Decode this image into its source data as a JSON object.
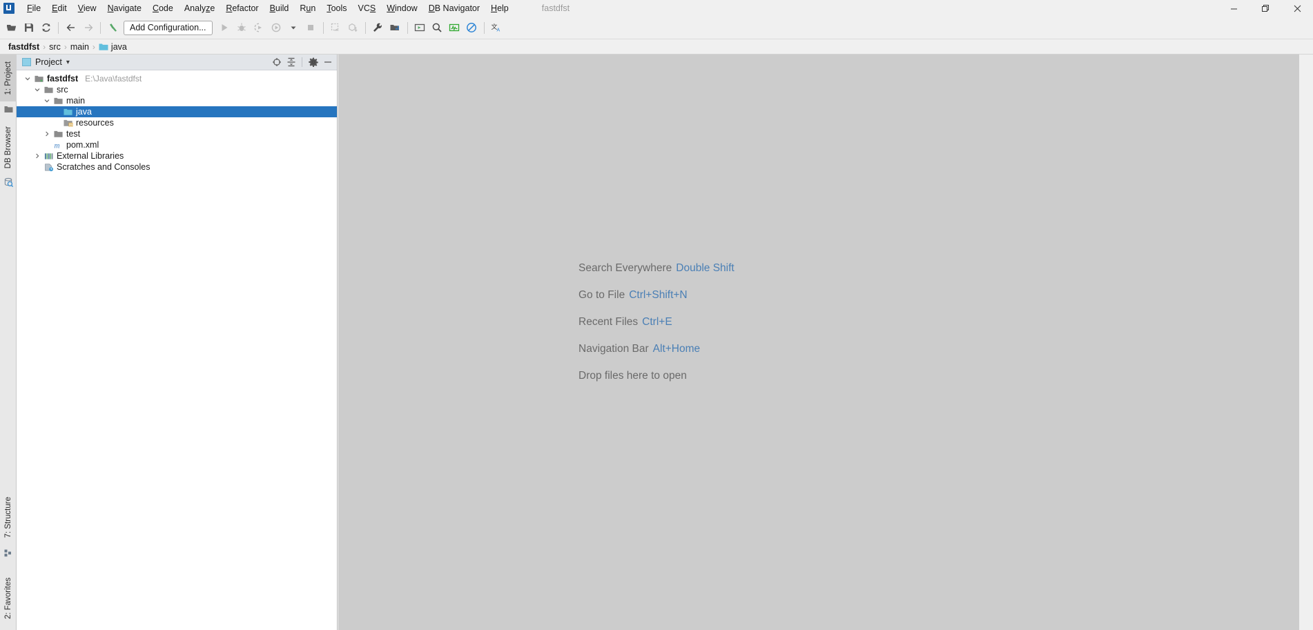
{
  "window": {
    "title": "fastdfst",
    "logo_name": "intellij-idea-logo",
    "controls": [
      {
        "name": "minimize-button",
        "glyph": "minimize"
      },
      {
        "name": "maximize-button",
        "glyph": "restore"
      },
      {
        "name": "close-button",
        "glyph": "close"
      }
    ]
  },
  "menubar": {
    "items": [
      {
        "label": "File",
        "mnemonic": "F"
      },
      {
        "label": "Edit",
        "mnemonic": "E"
      },
      {
        "label": "View",
        "mnemonic": "V"
      },
      {
        "label": "Navigate",
        "mnemonic": "N"
      },
      {
        "label": "Code",
        "mnemonic": "C"
      },
      {
        "label": "Analyze",
        "mnemonic": "z"
      },
      {
        "label": "Refactor",
        "mnemonic": "R"
      },
      {
        "label": "Build",
        "mnemonic": "B"
      },
      {
        "label": "Run",
        "mnemonic": "u"
      },
      {
        "label": "Tools",
        "mnemonic": "T"
      },
      {
        "label": "VCS",
        "mnemonic": "S"
      },
      {
        "label": "Window",
        "mnemonic": "W"
      },
      {
        "label": "DB Navigator",
        "mnemonic": "D"
      },
      {
        "label": "Help",
        "mnemonic": "H"
      }
    ]
  },
  "toolbar": {
    "add_configuration_label": "Add Configuration...",
    "icons": [
      {
        "name": "open-project-icon",
        "title": "Open"
      },
      {
        "name": "save-all-icon",
        "title": "Save All"
      },
      {
        "name": "sync-refresh-icon",
        "title": "Synchronize"
      },
      {
        "name": "navigate-back-icon",
        "title": "Back"
      },
      {
        "name": "navigate-forward-icon",
        "title": "Forward"
      },
      {
        "name": "build-hammer-icon",
        "title": "Build Project"
      },
      {
        "name": "run-icon",
        "title": "Run"
      },
      {
        "name": "debug-icon",
        "title": "Debug"
      },
      {
        "name": "run-with-coverage-icon",
        "title": "Run with Coverage"
      },
      {
        "name": "profile-icon",
        "title": "Profile"
      },
      {
        "name": "profile-dropdown-icon",
        "title": "More"
      },
      {
        "name": "stop-icon",
        "title": "Stop"
      },
      {
        "name": "update-project-icon",
        "title": "Update Project"
      },
      {
        "name": "commit-icon",
        "title": "Commit"
      },
      {
        "name": "settings-wrench-icon",
        "title": "Settings"
      },
      {
        "name": "project-structure-icon",
        "title": "Project Structure"
      },
      {
        "name": "db-console-icon",
        "title": "Open SQL Console"
      },
      {
        "name": "search-icon",
        "title": "Search Everywhere"
      },
      {
        "name": "db-monitor-icon",
        "title": "Database Monitor"
      },
      {
        "name": "disable-icon",
        "title": "Disable"
      },
      {
        "name": "translate-icon",
        "title": "Translate"
      }
    ]
  },
  "breadcrumb": {
    "items": [
      {
        "label": "fastdfst",
        "icon": "",
        "root": true
      },
      {
        "label": "src",
        "icon": "",
        "root": false
      },
      {
        "label": "main",
        "icon": "",
        "root": false
      },
      {
        "label": "java",
        "icon": "folder-source-icon",
        "root": false
      }
    ],
    "separator": "›"
  },
  "tool_strip": {
    "top_tabs": [
      {
        "name": "sidebar-tab-project",
        "label": "1: Project",
        "icon": "folder-icon",
        "active": true
      },
      {
        "name": "sidebar-tab-db-browser",
        "label": "DB Browser",
        "icon": "db-browser-icon",
        "active": false
      }
    ],
    "bottom_tabs": [
      {
        "name": "sidebar-tab-structure",
        "label": "7: Structure",
        "icon": "structure-icon",
        "active": false
      },
      {
        "name": "sidebar-tab-favorites",
        "label": "2: Favorites",
        "icon": "favorites-icon",
        "active": false
      }
    ]
  },
  "project_panel": {
    "title": "Project",
    "dropdown_glyph": "▾",
    "actions": [
      {
        "name": "scroll-from-source-icon",
        "title": "Select Opened File"
      },
      {
        "name": "collapse-all-icon",
        "title": "Collapse All"
      },
      {
        "name": "panel-settings-gear-icon",
        "title": "Settings"
      },
      {
        "name": "hide-panel-icon",
        "title": "Hide"
      }
    ],
    "tree": [
      {
        "name": "tree-node-fastdfst",
        "label": "fastdfst",
        "sub": "E:\\Java\\fastdfst",
        "indent": 0,
        "twisty": "down",
        "icon": "module-icon",
        "bold": true,
        "selected": false
      },
      {
        "name": "tree-node-src",
        "label": "src",
        "sub": "",
        "indent": 1,
        "twisty": "down",
        "icon": "folder-icon",
        "bold": false,
        "selected": false
      },
      {
        "name": "tree-node-main",
        "label": "main",
        "sub": "",
        "indent": 2,
        "twisty": "down",
        "icon": "folder-icon",
        "bold": false,
        "selected": false
      },
      {
        "name": "tree-node-java",
        "label": "java",
        "sub": "",
        "indent": 3,
        "twisty": "none",
        "icon": "source-root-icon",
        "bold": false,
        "selected": true
      },
      {
        "name": "tree-node-resources",
        "label": "resources",
        "sub": "",
        "indent": 3,
        "twisty": "none",
        "icon": "resource-root-icon",
        "bold": false,
        "selected": false
      },
      {
        "name": "tree-node-test",
        "label": "test",
        "sub": "",
        "indent": 2,
        "twisty": "right",
        "icon": "folder-icon",
        "bold": false,
        "selected": false
      },
      {
        "name": "tree-node-pom-xml",
        "label": "pom.xml",
        "sub": "",
        "indent": 2,
        "twisty": "none",
        "icon": "maven-icon",
        "bold": false,
        "selected": false
      },
      {
        "name": "tree-node-external-libraries",
        "label": "External Libraries",
        "sub": "",
        "indent": 1,
        "twisty": "right",
        "icon": "libraries-icon",
        "bold": false,
        "selected": false
      },
      {
        "name": "tree-node-scratches-and-consoles",
        "label": "Scratches and Consoles",
        "sub": "",
        "indent": 1,
        "twisty": "none",
        "icon": "scratches-icon",
        "bold": false,
        "selected": false
      }
    ]
  },
  "welcome": {
    "rows": [
      {
        "name": "welcome-search-everywhere",
        "text": "Search Everywhere",
        "key": "Double Shift"
      },
      {
        "name": "welcome-go-to-file",
        "text": "Go to File",
        "key": "Ctrl+Shift+N"
      },
      {
        "name": "welcome-recent-files",
        "text": "Recent Files",
        "key": "Ctrl+E"
      },
      {
        "name": "welcome-navigation-bar",
        "text": "Navigation Bar",
        "key": "Alt+Home"
      },
      {
        "name": "welcome-drop-files",
        "text": "Drop files here to open",
        "key": ""
      }
    ]
  },
  "colors": {
    "accent_blue": "#2675bf",
    "link_blue": "#4a7fb5",
    "editor_bg": "#cccccc",
    "chrome_bg": "#f0f0f0",
    "panel_header_bg": "#e2e5e9",
    "tree_bg": "#ffffff",
    "folder_gray": "#8c8c8c",
    "source_cyan": "#62bfdd"
  }
}
